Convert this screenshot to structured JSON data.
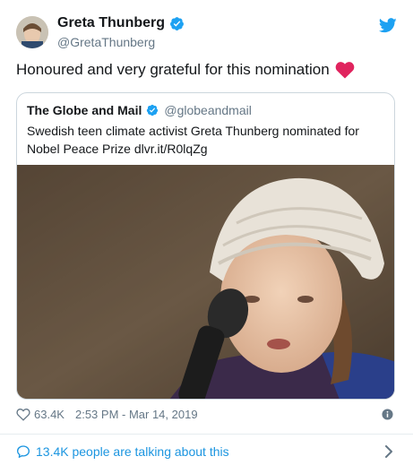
{
  "author": {
    "name": "Greta Thunberg",
    "handle": "@GretaThunberg",
    "avatar_icon": "profile-avatar",
    "verified_icon": "verified-badge-icon"
  },
  "tweet": {
    "text": "Honoured and very grateful for this nomination",
    "emoji_icon": "red-heart-icon"
  },
  "quote": {
    "name": "The Globe and Mail",
    "handle": "@globeandmail",
    "text": "Swedish teen climate activist Greta Thunberg nominated for Nobel Peace Prize dlvr.it/R0lqZg",
    "image_icon": "photo-girl-with-microphone"
  },
  "meta": {
    "likes": "63.4K",
    "timestamp": "2:53 PM - Mar 14, 2019"
  },
  "talking": {
    "label": "13.4K people are talking about this"
  },
  "colors": {
    "accent": "#1da1f2",
    "link": "#1b95e0",
    "secondary_text": "#657786",
    "heart": "#e0245e",
    "border": "#ccd6dd"
  }
}
